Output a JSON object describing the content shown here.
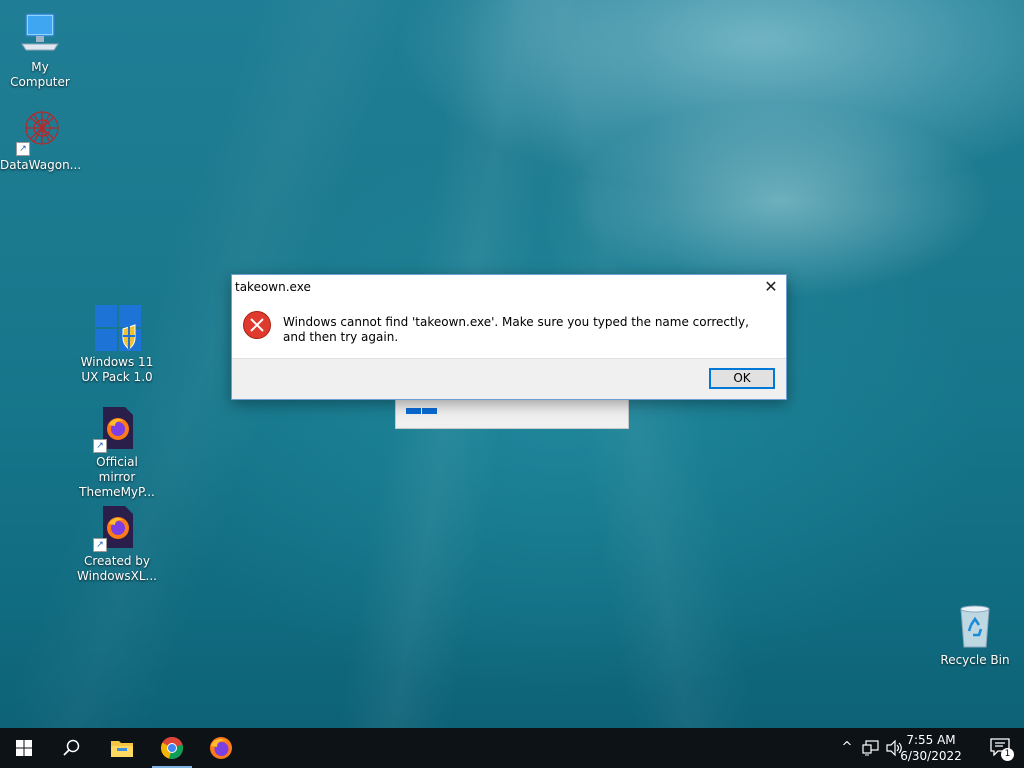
{
  "desktop": {
    "icons": [
      {
        "label": "My Computer"
      },
      {
        "label": "DataWagon..."
      },
      {
        "label": "Windows 11 UX Pack 1.0"
      },
      {
        "label": "Official mirror ThemeMyP..."
      },
      {
        "label": "Created by WindowsXL..."
      },
      {
        "label": "Recycle Bin"
      }
    ]
  },
  "dialog": {
    "title": "takeown.exe",
    "close_glyph": "✕",
    "icon": "error-icon",
    "message": "Windows cannot find 'takeown.exe'. Make sure you typed the name correctly, and then try again.",
    "ok_label": "OK"
  },
  "taskbar": {
    "buttons": [
      "start-icon",
      "search-icon",
      "file-explorer-icon",
      "chrome-icon",
      "firefox-icon"
    ],
    "tray": {
      "chevron": "^",
      "time": "7:55 AM",
      "date": "6/30/2022",
      "notification_count": "1"
    }
  },
  "colors": {
    "accent": "#0078d7",
    "error": "#e03a2f",
    "taskbar": "#0d1217"
  }
}
